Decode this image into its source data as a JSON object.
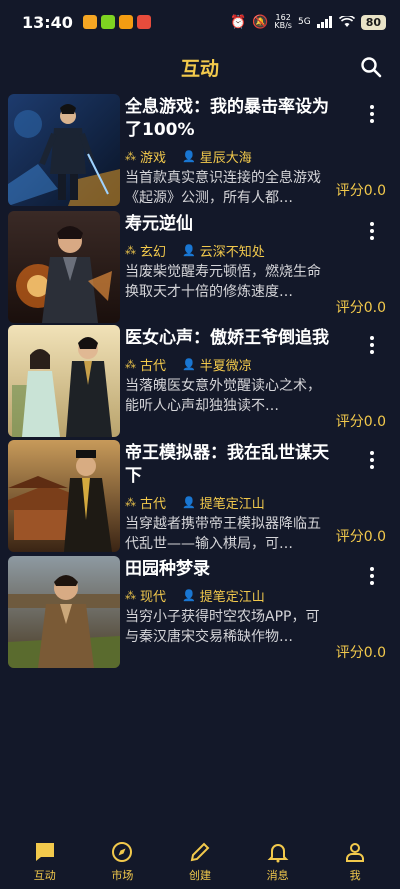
{
  "status_bar": {
    "time": "13:40",
    "net_speed_value": "162",
    "net_speed_unit": "KB/s",
    "signal": "5G",
    "battery": "80"
  },
  "header": {
    "title": "互动"
  },
  "books": [
    {
      "title": "全息游戏：我的暴击率设为了100%",
      "genre": "游戏",
      "author": "星辰大海",
      "description": "当首款真实意识连接的全息游戏《起源》公测，所有人都…",
      "rating": "评分0.0"
    },
    {
      "title": "寿元逆仙",
      "genre": "玄幻",
      "author": "云深不知处",
      "description": "当废柴觉醒寿元顿悟，燃烧生命换取天才十倍的修炼速度…",
      "rating": "评分0.0"
    },
    {
      "title": "医女心声：傲娇王爷倒追我",
      "genre": "古代",
      "author": "半夏微凉",
      "description": "当落魄医女意外觉醒读心之术，能听人心声却独独读不…",
      "rating": "评分0.0"
    },
    {
      "title": "帝王模拟器：我在乱世谋天下",
      "genre": "古代",
      "author": "提笔定江山",
      "description": "当穿越者携带帝王模拟器降临五代乱世——输入棋局，可…",
      "rating": "评分0.0"
    },
    {
      "title": "田园种梦录",
      "genre": "现代",
      "author": "提笔定江山",
      "description": "当穷小子获得时空农场APP，可与秦汉唐宋交易稀缺作物…",
      "rating": "评分0.0"
    }
  ],
  "nav": [
    {
      "label": "互动",
      "icon": "chat-icon",
      "active": true
    },
    {
      "label": "市场",
      "icon": "compass-icon"
    },
    {
      "label": "创建",
      "icon": "pencil-icon"
    },
    {
      "label": "消息",
      "icon": "bell-icon"
    },
    {
      "label": "我",
      "icon": "person-icon"
    }
  ],
  "colors": {
    "background": "#131829",
    "accent": "#f2c94c",
    "text": "#ffffff",
    "muted_text": "#d4d4d8"
  }
}
